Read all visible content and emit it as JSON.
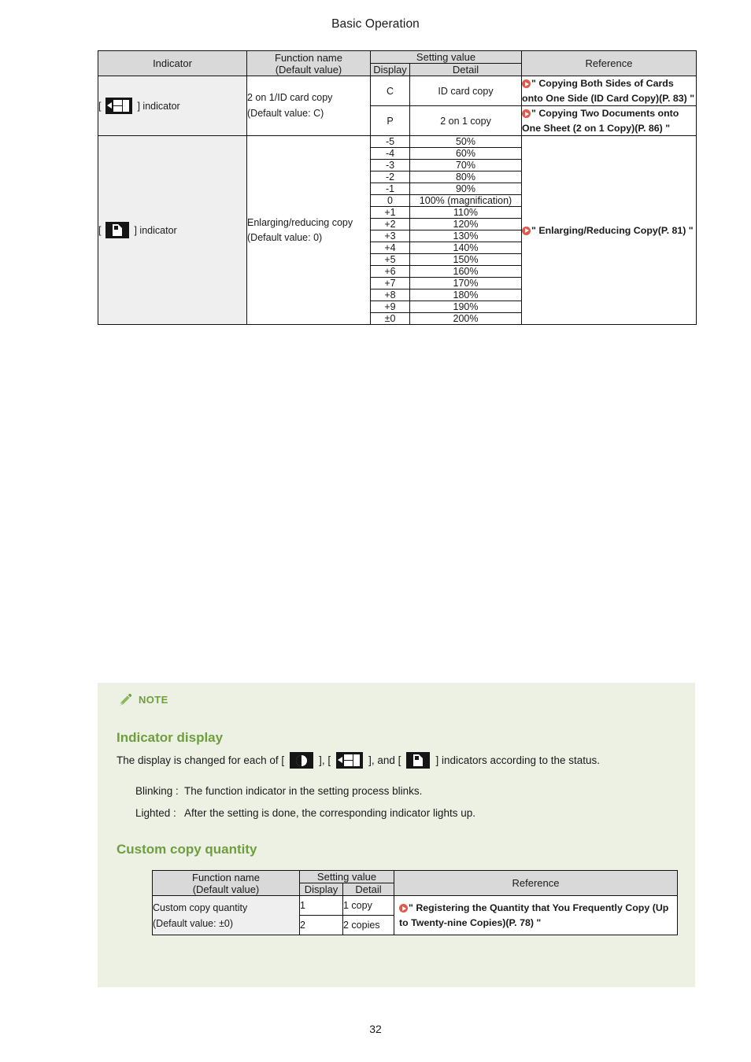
{
  "page": {
    "header_title": "Basic Operation",
    "page_number": "32"
  },
  "main_table": {
    "headers": {
      "indicator": "Indicator",
      "function_name_line1": "Function name",
      "function_name_line2": "(Default value)",
      "setting_value": "Setting value",
      "display": "Display",
      "detail": "Detail",
      "reference": "Reference"
    },
    "rows": [
      {
        "indicator_label": "] indicator",
        "indicator_bracket": "[",
        "indicator_icon": "two-on-one-id-card-icon",
        "function_line1": "2 on 1/ID card copy",
        "function_line2": "(Default value: C)",
        "settings": [
          {
            "display": "C",
            "detail": "ID card copy",
            "reference": "\" Copying Both Sides of Cards onto One Side (ID Card Copy)(P. 83) \""
          },
          {
            "display": "P",
            "detail": "2 on 1 copy",
            "reference": "\" Copying Two Documents onto One Sheet (2 on 1 Copy)(P. 86) \""
          }
        ]
      },
      {
        "indicator_label": "] indicator",
        "indicator_bracket": "[",
        "indicator_icon": "enlarge-reduce-icon",
        "function_line1": "Enlarging/reducing copy",
        "function_line2": "(Default value: 0)",
        "reference": "\" Enlarging/Reducing Copy(P. 81) \"",
        "settings": [
          {
            "display": "-5",
            "detail": "50%"
          },
          {
            "display": "-4",
            "detail": "60%"
          },
          {
            "display": "-3",
            "detail": "70%"
          },
          {
            "display": "-2",
            "detail": "80%"
          },
          {
            "display": "-1",
            "detail": "90%"
          },
          {
            "display": "0",
            "detail": "100% (magnification)"
          },
          {
            "display": "+1",
            "detail": "110%"
          },
          {
            "display": "+2",
            "detail": "120%"
          },
          {
            "display": "+3",
            "detail": "130%"
          },
          {
            "display": "+4",
            "detail": "140%"
          },
          {
            "display": "+5",
            "detail": "150%"
          },
          {
            "display": "+6",
            "detail": "160%"
          },
          {
            "display": "+7",
            "detail": "170%"
          },
          {
            "display": "+8",
            "detail": "180%"
          },
          {
            "display": "+9",
            "detail": "190%"
          },
          {
            "display": "±0",
            "detail": "200%"
          }
        ]
      }
    ]
  },
  "note": {
    "label": "NOTE",
    "heading_indicator_display": "Indicator display",
    "sentence_part1": "The display is changed for each of [",
    "sentence_part2": "], [",
    "sentence_part3": "], and [",
    "sentence_part4": "] indicators according to the status.",
    "blinking_label": "Blinking :",
    "blinking_text": "The function indicator in the setting process blinks.",
    "lighted_label": "Lighted :",
    "lighted_text": "After the setting is done, the corresponding indicator lights up.",
    "heading_custom_copy": "Custom copy quantity",
    "icons": [
      "density-icon",
      "two-on-one-id-card-icon",
      "enlarge-reduce-icon"
    ]
  },
  "custom_copy_table": {
    "headers": {
      "function_name_line1": "Function name",
      "function_name_line2": "(Default value)",
      "setting_value": "Setting value",
      "display": "Display",
      "detail": "Detail",
      "reference": "Reference"
    },
    "row": {
      "function_line1": "Custom copy quantity",
      "function_line2": "(Default value: ±0)",
      "settings": [
        {
          "display": "1",
          "detail": "1 copy"
        },
        {
          "display": "2",
          "detail": "2 copies"
        }
      ],
      "reference": "\" Registering the Quantity that You Frequently Copy (Up to Twenty-nine Copies)(P. 78) \""
    }
  },
  "colors": {
    "header_fill": "#d9d9d9",
    "indicator_fill": "#efefef",
    "note_bg": "#ecf1e4",
    "note_green": "#6f9e3f",
    "ref_red": "#e0594c",
    "border": "#111111"
  }
}
